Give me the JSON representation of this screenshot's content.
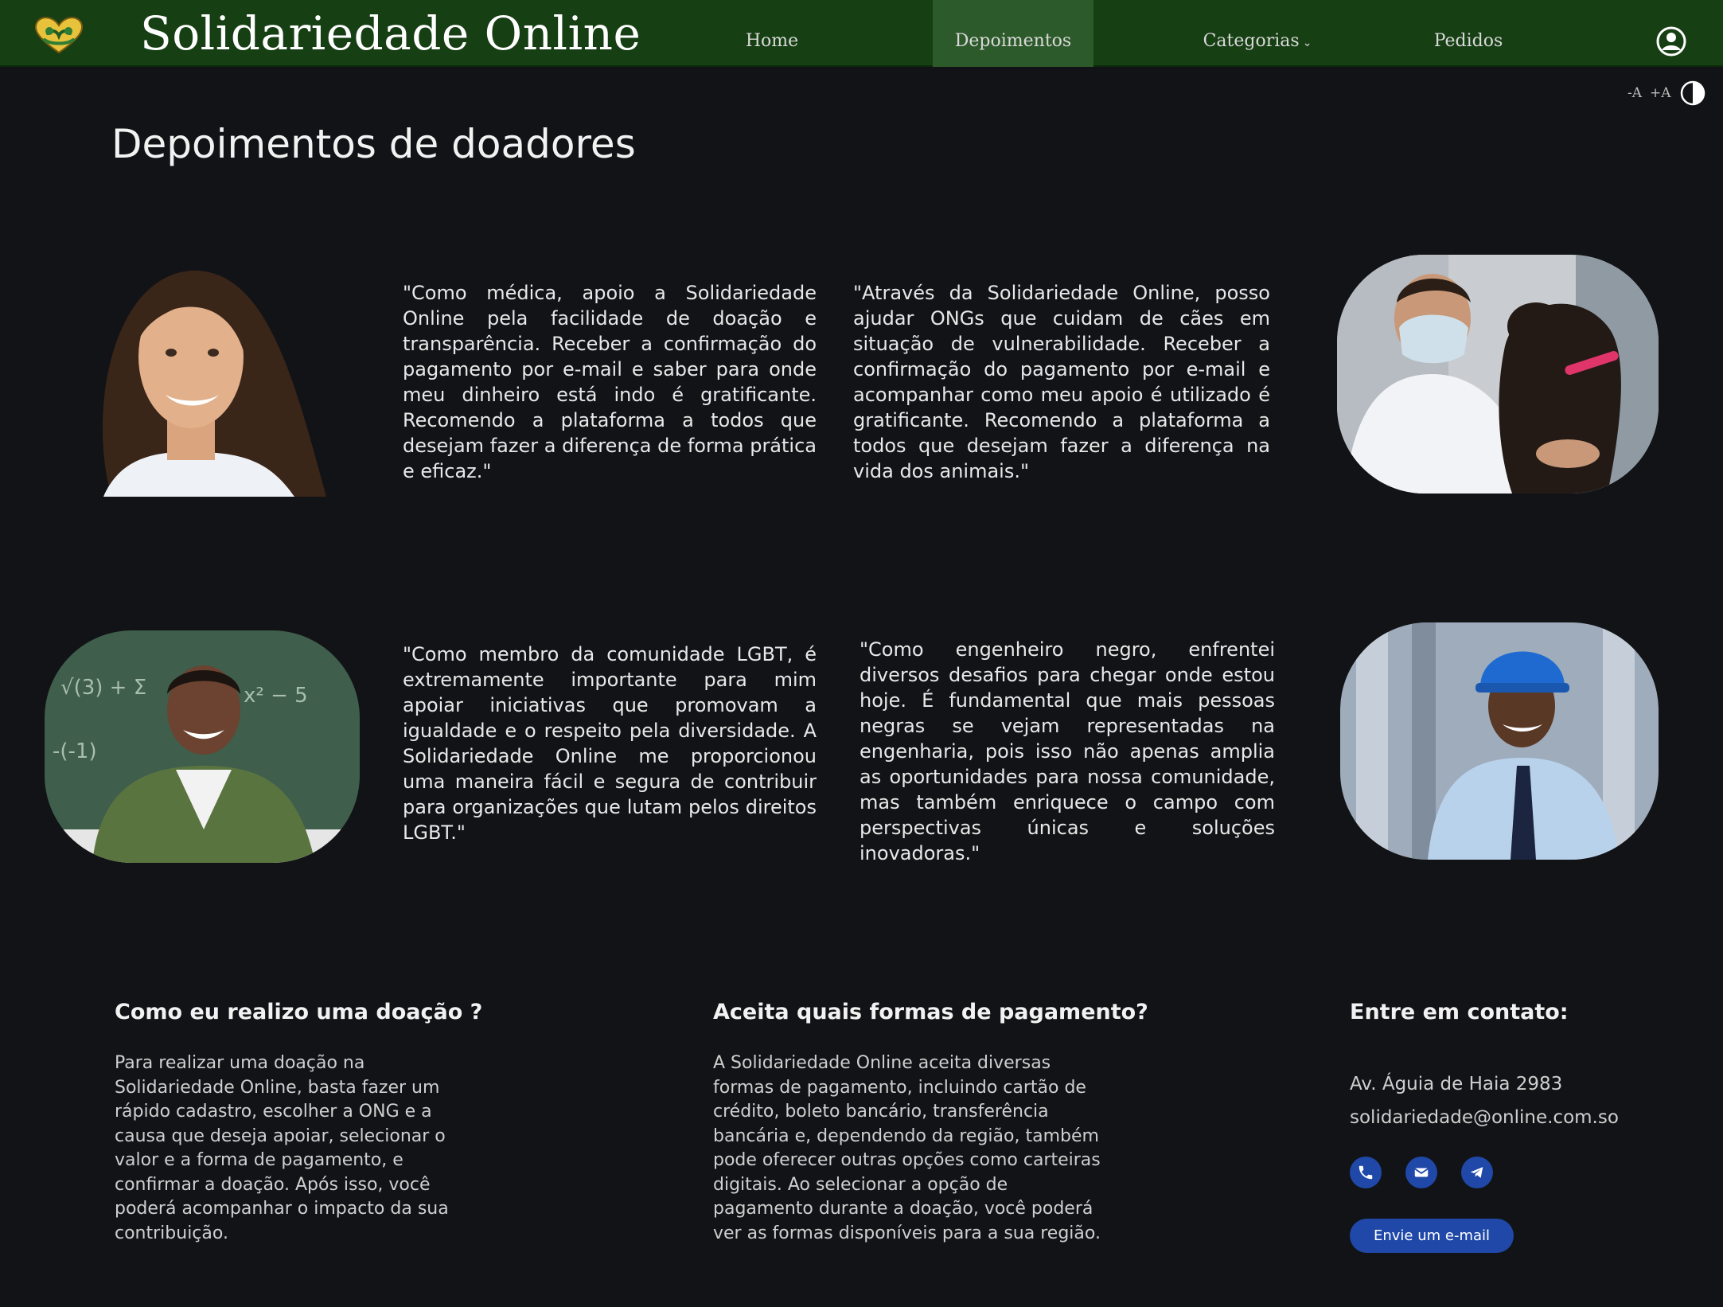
{
  "brand": {
    "name": "Solidariedade Online"
  },
  "nav": {
    "items": [
      {
        "label": "Home"
      },
      {
        "label": "Depoimentos"
      },
      {
        "label": "Categorias",
        "caret": "⌄"
      },
      {
        "label": "Pedidos"
      }
    ],
    "active": "Depoimentos"
  },
  "accessibility": {
    "decrease_label": "-A",
    "increase_label": "+A"
  },
  "page": {
    "title": "Depoimentos de doadores"
  },
  "testimonials": [
    {
      "quote": "\"Como médica, apoio a Solidariedade Online pela facilidade de doação e transparência. Receber a confirmação do pagamento por e-mail e saber para onde meu dinheiro está indo é gratificante. Recomendo a plataforma a todos que desejam fazer a diferença de forma prática e eficaz.\""
    },
    {
      "quote": "\"Através da Solidariedade Online, posso ajudar ONGs que cuidam de cães em situação de vulnerabilidade. Receber a confirmação do pagamento por e-mail e acompanhar como meu apoio é utilizado é gratificante. Recomendo a plataforma a todos que desejam fazer a diferença na vida dos animais.\""
    },
    {
      "quote": "\"Como membro da comunidade LGBT, é extremamente importante para mim apoiar iniciativas que promovam a igualdade e o respeito pela diversidade. A Solidariedade Online me proporcionou uma maneira fácil e segura de contribuir para organizações que lutam pelos direitos LGBT.\""
    },
    {
      "quote": "\"Como engenheiro negro, enfrentei diversos desafios para chegar onde estou hoje. É fundamental que mais pessoas negras se vejam representadas na engenharia, pois isso não apenas amplia as oportunidades para nossa comunidade, mas também enriquece o campo com perspectivas únicas e soluções inovadoras.\""
    }
  ],
  "footer": {
    "how_to": {
      "title": "Como eu realizo uma doação ?",
      "text": "Para realizar uma doação na Solidariedade Online, basta fazer um rápido cadastro, escolher a ONG e a causa que deseja apoiar, selecionar o valor e a forma de pagamento, e confirmar a doação. Após isso, você poderá acompanhar o impacto da sua contribuição."
    },
    "payments": {
      "title": "Aceita quais formas de pagamento?",
      "text": "A Solidariedade Online aceita diversas formas de pagamento, incluindo cartão de crédito, boleto bancário, transferência bancária e, dependendo da região, também pode oferecer outras opções como carteiras digitais. Ao selecionar a opção de pagamento durante a doação, você poderá ver as formas disponíveis para a sua região."
    },
    "contact": {
      "title": "Entre em contato:",
      "address": "Av. Águia de Haia 2983",
      "email": "solidariedade@online.com.so",
      "icons": [
        "phone-icon",
        "mail-icon",
        "telegram-icon"
      ],
      "button_label": "Envie um e-mail"
    }
  },
  "colors": {
    "navbar": "#163f13",
    "nav_active": "#2d5a2a",
    "background": "#121316",
    "accent_blue": "#1f48a8"
  }
}
